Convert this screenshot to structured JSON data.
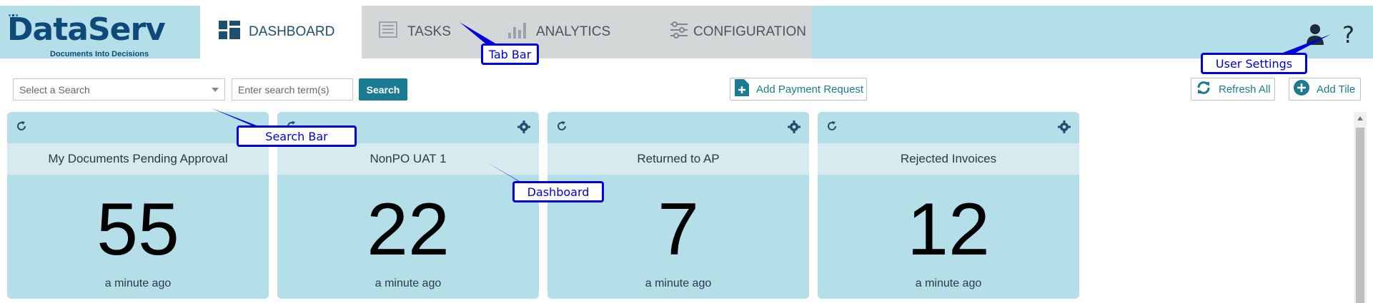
{
  "brand": {
    "name": "DataServ",
    "tagline": "Documents Into Decisions"
  },
  "tabs": [
    {
      "label": "DASHBOARD",
      "icon": "dashboard-icon",
      "active": true
    },
    {
      "label": "TASKS",
      "icon": "tasks-icon",
      "active": false
    },
    {
      "label": "ANALYTICS",
      "icon": "analytics-icon",
      "active": false
    },
    {
      "label": "CONFIGURATION",
      "icon": "configuration-icon",
      "active": false
    }
  ],
  "header": {
    "user_icon": "user-icon",
    "help_label": "?"
  },
  "search": {
    "select_placeholder": "Select a Search",
    "input_placeholder": "Enter search term(s)",
    "button_label": "Search"
  },
  "toolbar": {
    "add_payment_label": "Add Payment Request",
    "refresh_all_label": "Refresh All",
    "add_tile_label": "Add Tile"
  },
  "tiles": [
    {
      "title": "My Documents Pending Approval",
      "count": "55",
      "updated": "a minute ago"
    },
    {
      "title": "NonPO UAT 1",
      "count": "22",
      "updated": "a minute ago"
    },
    {
      "title": "Returned to AP",
      "count": "7",
      "updated": "a minute ago"
    },
    {
      "title": "Rejected Invoices",
      "count": "12",
      "updated": "a minute ago"
    }
  ],
  "annotations": {
    "tab_bar": "Tab Bar",
    "user_settings": "User Settings",
    "search_bar": "Search Bar",
    "dashboard": "Dashboard"
  },
  "colors": {
    "header_bg": "#b5dfe8",
    "tile_bg": "#b5dfe8",
    "accent": "#1b7b93",
    "brand": "#0d4a7a",
    "annotation": "#0000dd"
  }
}
